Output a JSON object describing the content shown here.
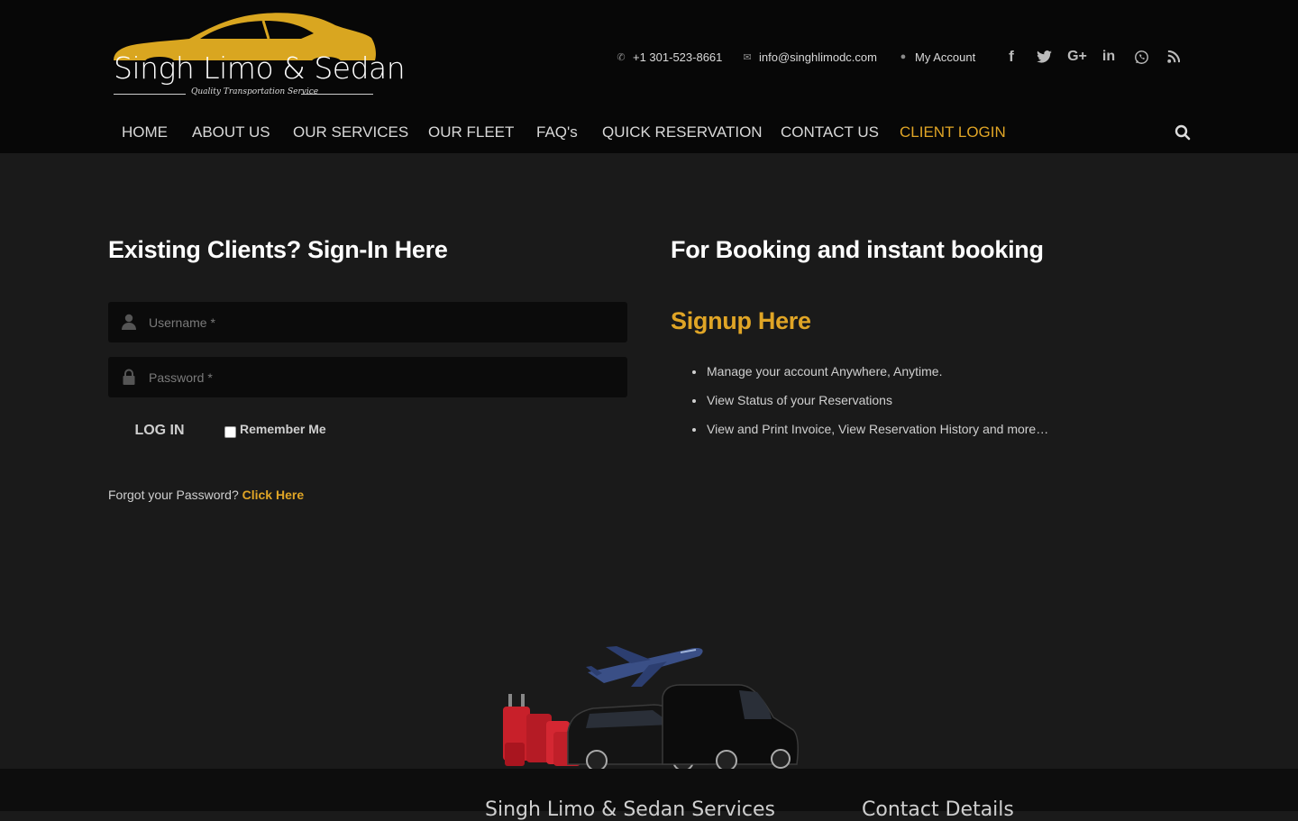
{
  "brand": {
    "name": "Singh Limo & Sedan",
    "tagline": "Quality Transportation Service",
    "gold": "#e0a526"
  },
  "topbar": {
    "phone": "+1 301-523-8661",
    "email": "info@singhlimodc.com",
    "account": "My Account",
    "social_icons": [
      "facebook-icon",
      "twitter-icon",
      "google-plus-icon",
      "linkedin-icon",
      "whatsapp-icon",
      "rss-icon"
    ]
  },
  "nav": {
    "items": [
      {
        "label": "HOME"
      },
      {
        "label": "ABOUT US"
      },
      {
        "label": "OUR SERVICES"
      },
      {
        "label": "OUR FLEET"
      },
      {
        "label": "FAQ's"
      },
      {
        "label": "QUICK RESERVATION"
      },
      {
        "label": "CONTACT US"
      },
      {
        "label": "CLIENT LOGIN"
      }
    ],
    "active": "CLIENT LOGIN"
  },
  "login": {
    "heading": "Existing Clients? Sign-In Here",
    "username_placeholder": "Username *",
    "password_placeholder": "Password *",
    "login_button": "LOG IN",
    "remember_label": "Remember Me",
    "forgot_text": "Forgot your Password?",
    "forgot_link": "Click Here"
  },
  "booking": {
    "heading": "For Booking and instant booking",
    "signup": "Signup Here",
    "benefits": [
      "Manage your account Anywhere, Anytime.",
      "View Status of your Reservations",
      "View and Print Invoice, View Reservation History and more…"
    ]
  },
  "footer": {
    "col1": "Singh Limo & Sedan Services",
    "col2": "Contact Details"
  }
}
